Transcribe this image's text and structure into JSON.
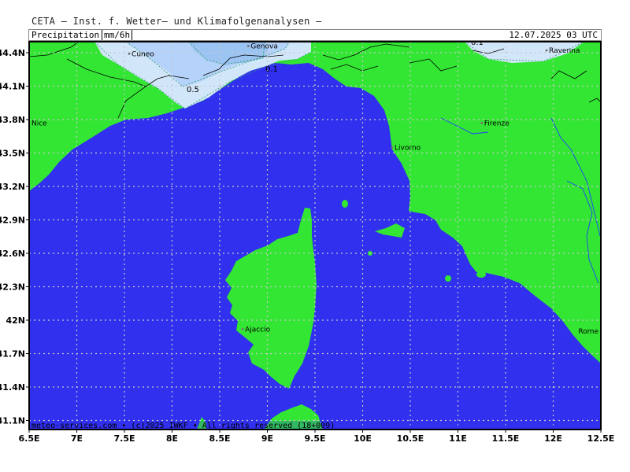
{
  "title": "CETA — Inst. f. Wetter— und Klimafolgenanalysen —",
  "parameter": "Precipitation",
  "unit": "mm/6h",
  "datetime": "12.07.2025 03 UTC",
  "footer": "meteo-services.com • (c)2025 IWKF • All rights reserved (18+009)",
  "colors": {
    "sea": "#3030ee",
    "land": "#33e633",
    "precip_light": "#d2e6fa",
    "precip_medium": "#b4d2fa",
    "precip_heavy": "#9cc4f2",
    "grid": "#c8c8c8",
    "border": "#000000",
    "river": "#2040ff"
  },
  "x_ticks": [
    "6.5E",
    "7E",
    "7.5E",
    "8E",
    "8.5E",
    "9E",
    "9.5E",
    "10E",
    "10.5E",
    "11E",
    "11.5E",
    "12E",
    "12.5E"
  ],
  "y_ticks": [
    "44.4N",
    "44.1N",
    "43.8N",
    "43.5N",
    "43.2N",
    "42.9N",
    "42.6N",
    "42.3N",
    "42N",
    "41.7N",
    "41.4N",
    "41.1N"
  ],
  "cities": [
    {
      "name": "Cuneo",
      "lon": 7.55,
      "lat": 44.39
    },
    {
      "name": "Genova",
      "lon": 8.8,
      "lat": 44.46
    },
    {
      "name": "Ravenna",
      "lon": 11.93,
      "lat": 44.42
    },
    {
      "name": "Nice",
      "lon": 6.5,
      "lat": 43.77
    },
    {
      "name": "Firenze",
      "lon": 11.25,
      "lat": 43.77
    },
    {
      "name": "Livorno",
      "lon": 10.31,
      "lat": 43.55
    },
    {
      "name": "Ajaccio",
      "lon": 8.74,
      "lat": 41.92
    },
    {
      "name": "Rome",
      "lon": 12.5,
      "lat": 41.9
    }
  ],
  "contour_labels": [
    "0.5",
    "0.1",
    "0.1"
  ]
}
